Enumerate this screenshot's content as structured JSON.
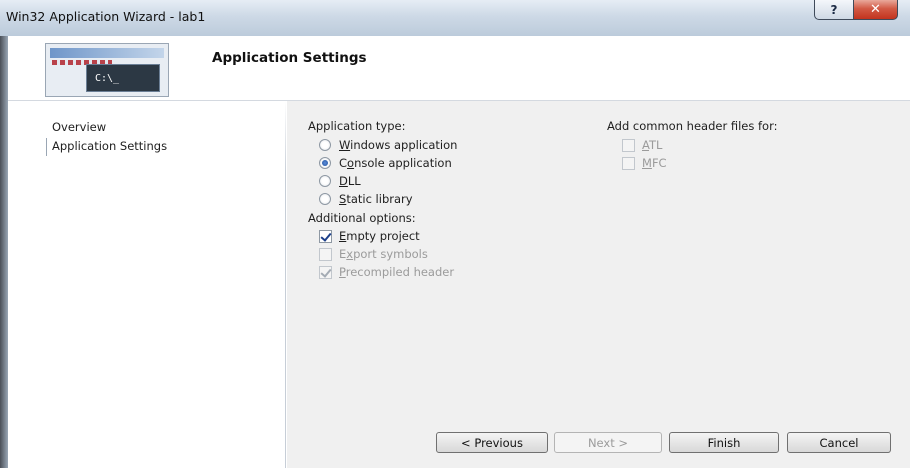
{
  "window": {
    "title": "Win32 Application Wizard - lab1",
    "help_label": "?",
    "close_label": "✕"
  },
  "header": {
    "title": "Application Settings",
    "icon_text": "C:\\_"
  },
  "nav": {
    "items": [
      {
        "label": "Overview"
      },
      {
        "label": "Application Settings"
      }
    ]
  },
  "settings": {
    "app_type_label": "Application type:",
    "app_types": [
      {
        "pre": "",
        "key": "W",
        "post": "indows application",
        "checked": false
      },
      {
        "pre": "C",
        "key": "o",
        "post": "nsole application",
        "checked": true
      },
      {
        "pre": "",
        "key": "D",
        "post": "LL",
        "checked": false
      },
      {
        "pre": "",
        "key": "S",
        "post": "tatic library",
        "checked": false
      }
    ],
    "additional_label": "Additional options:",
    "options": [
      {
        "pre": "",
        "key": "E",
        "post": "mpty project",
        "checked": true,
        "enabled": true
      },
      {
        "pre": "E",
        "key": "x",
        "post": "port symbols",
        "checked": false,
        "enabled": false
      },
      {
        "pre": "",
        "key": "P",
        "post": "recompiled header",
        "checked": true,
        "enabled": false
      }
    ],
    "headers_label": "Add common header files for:",
    "headers": [
      {
        "pre": "",
        "key": "A",
        "post": "TL",
        "checked": false,
        "enabled": false
      },
      {
        "pre": "",
        "key": "M",
        "post": "FC",
        "checked": false,
        "enabled": false
      }
    ]
  },
  "buttons": {
    "previous": "< Previous",
    "next": "Next >",
    "finish": "Finish",
    "cancel": "Cancel"
  }
}
